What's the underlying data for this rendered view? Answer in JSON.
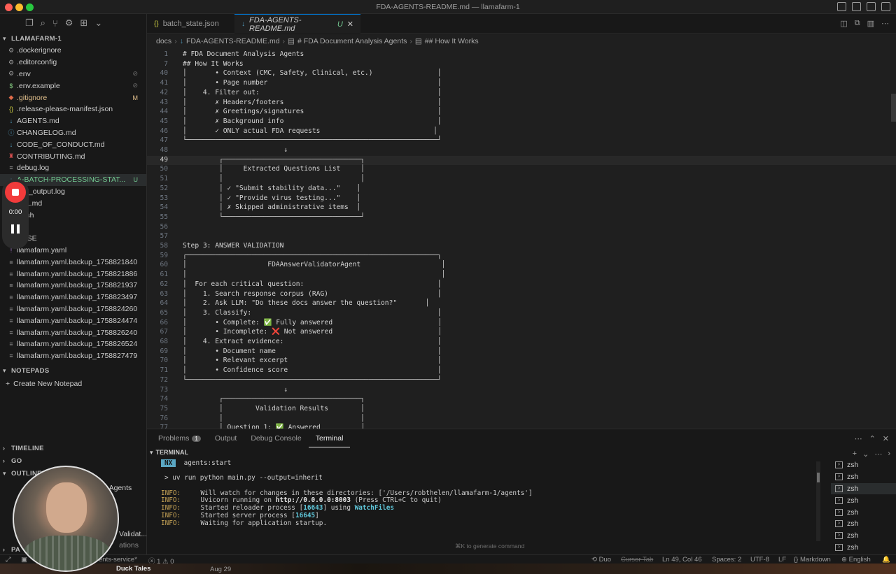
{
  "window": {
    "title": "FDA-AGENTS-README.md — llamafarm-1"
  },
  "sidebar": {
    "project": "LLAMAFARM-1",
    "files": [
      {
        "icon": "gear",
        "name": ".dockerignore",
        "badge": "",
        "color": "#cccccc"
      },
      {
        "icon": "gear",
        "name": ".editorconfig",
        "badge": "",
        "color": "#cccccc"
      },
      {
        "icon": "gear",
        "name": ".env",
        "badge": "⊘",
        "color": "#cccccc"
      },
      {
        "icon": "dollar",
        "name": ".env.example",
        "badge": "⊘",
        "color": "#cccccc"
      },
      {
        "icon": "git",
        "name": ".gitignore",
        "badge": "M",
        "color": "#e2c08d"
      },
      {
        "icon": "braces",
        "name": ".release-please-manifest.json",
        "badge": "",
        "color": "#cccccc"
      },
      {
        "icon": "md",
        "name": "AGENTS.md",
        "badge": "",
        "color": "#cccccc"
      },
      {
        "icon": "info",
        "name": "CHANGELOG.md",
        "badge": "",
        "color": "#cccccc"
      },
      {
        "icon": "md",
        "name": "CODE_OF_CONDUCT.md",
        "badge": "",
        "color": "#cccccc"
      },
      {
        "icon": "contrib",
        "name": "CONTRIBUTING.md",
        "badge": "",
        "color": "#cccccc"
      },
      {
        "icon": "lines",
        "name": "debug.log",
        "badge": "",
        "color": "#cccccc"
      },
      {
        "icon": "md",
        "name": "A-BATCH-PROCESSING-STAT...",
        "badge": "U",
        "color": "#73c991"
      },
      {
        "icon": "lines",
        "name": "test_output.log",
        "badge": "",
        "color": "#cccccc"
      },
      {
        "icon": "md",
        "name": "ALL.md",
        "badge": "",
        "color": "#cccccc"
      },
      {
        "icon": "dollar",
        "name": "all.sh",
        "badge": "",
        "color": "#cccccc"
      },
      {
        "icon": "none",
        "name": "",
        "badge": "",
        "color": "#cccccc"
      },
      {
        "icon": "lines",
        "name": "ENSE",
        "badge": "",
        "color": "#cccccc"
      },
      {
        "icon": "yaml",
        "name": "llamafarm.yaml",
        "badge": "",
        "color": "#cccccc"
      },
      {
        "icon": "lines",
        "name": "llamafarm.yaml.backup_1758821840",
        "badge": "",
        "color": "#cccccc"
      },
      {
        "icon": "lines",
        "name": "llamafarm.yaml.backup_1758821886",
        "badge": "",
        "color": "#cccccc"
      },
      {
        "icon": "lines",
        "name": "llamafarm.yaml.backup_1758821937",
        "badge": "",
        "color": "#cccccc"
      },
      {
        "icon": "lines",
        "name": "llamafarm.yaml.backup_1758823497",
        "badge": "",
        "color": "#cccccc"
      },
      {
        "icon": "lines",
        "name": "llamafarm.yaml.backup_1758824260",
        "badge": "",
        "color": "#cccccc"
      },
      {
        "icon": "lines",
        "name": "llamafarm.yaml.backup_1758824474",
        "badge": "",
        "color": "#cccccc"
      },
      {
        "icon": "lines",
        "name": "llamafarm.yaml.backup_1758826240",
        "badge": "",
        "color": "#cccccc"
      },
      {
        "icon": "lines",
        "name": "llamafarm.yaml.backup_1758826524",
        "badge": "",
        "color": "#cccccc"
      },
      {
        "icon": "lines",
        "name": "llamafarm.yaml.backup_1758827479",
        "badge": "",
        "color": "#cccccc"
      }
    ],
    "notepads_label": "NOTEPADS",
    "create_notepad": "Create New Notepad",
    "timeline_label": "TIMELINE",
    "go_label": "GO",
    "outline_label": "OUTLINE",
    "outline_peek1": "s Agents",
    "outline_peek2": "Validat...",
    "outline_peek3": "ations",
    "pa_label": "PA"
  },
  "recording": {
    "time": "0:00"
  },
  "tabs": [
    {
      "label": "batch_state.json",
      "icon": "{}",
      "active": false,
      "modified": ""
    },
    {
      "label": "FDA-AGENTS-README.md",
      "icon": "↓",
      "active": true,
      "modified": "U"
    }
  ],
  "breadcrumb": [
    "docs",
    "FDA-AGENTS-README.md",
    "# FDA Document Analysis Agents",
    "## How It Works"
  ],
  "editor": {
    "current_line": "49",
    "lines": [
      {
        "n": "1",
        "t": "# FDA Document Analysis Agents"
      },
      {
        "n": "7",
        "t": "## How It Works"
      },
      {
        "n": "40",
        "t": "│       • Context (CMC, Safety, Clinical, etc.)                │"
      },
      {
        "n": "41",
        "t": "│       • Page number                                          │"
      },
      {
        "n": "42",
        "t": "│    4. Filter out:                                            │"
      },
      {
        "n": "43",
        "t": "│       ✗ Headers/footers                                      │"
      },
      {
        "n": "44",
        "t": "│       ✗ Greetings/signatures                                 │"
      },
      {
        "n": "45",
        "t": "│       ✗ Background info                                      │"
      },
      {
        "n": "46",
        "t": "│       ✓ ONLY actual FDA requests                            │"
      },
      {
        "n": "47",
        "t": "└──────────────────────────────────────────────────────────────┘"
      },
      {
        "n": "48",
        "t": "                         ↓"
      },
      {
        "n": "49",
        "t": "         ┌──────────────────────────────────┐"
      },
      {
        "n": "50",
        "t": "         │     Extracted Questions List     │"
      },
      {
        "n": "51",
        "t": "         │                                  │"
      },
      {
        "n": "52",
        "t": "         │ ✓ \"Submit stability data...\"    │"
      },
      {
        "n": "53",
        "t": "         │ ✓ \"Provide virus testing...\"    │"
      },
      {
        "n": "54",
        "t": "         │ ✗ Skipped administrative items  │"
      },
      {
        "n": "55",
        "t": "         └──────────────────────────────────┘"
      },
      {
        "n": "56",
        "t": ""
      },
      {
        "n": "57",
        "t": ""
      },
      {
        "n": "58",
        "t": "Step 3: ANSWER VALIDATION"
      },
      {
        "n": "59",
        "t": "┌──────────────────────────────────────────────────────────────┐"
      },
      {
        "n": "60",
        "t": "│                    FDAAnswerValidatorAgent                    │"
      },
      {
        "n": "61",
        "t": "│                                                               │"
      },
      {
        "n": "62",
        "t": "│  For each critical question:                                 │"
      },
      {
        "n": "63",
        "t": "│    1. Search response corpus (RAG)                           │"
      },
      {
        "n": "64",
        "t": "│    2. Ask LLM: \"Do these docs answer the question?\"       │"
      },
      {
        "n": "65",
        "t": "│    3. Classify:                                              │"
      },
      {
        "n": "66",
        "t": "│       • Complete: ✅ Fully answered                          │"
      },
      {
        "n": "67",
        "t": "│       • Incomplete: ❌ Not answered                          │"
      },
      {
        "n": "68",
        "t": "│    4. Extract evidence:                                      │"
      },
      {
        "n": "69",
        "t": "│       • Document name                                        │"
      },
      {
        "n": "70",
        "t": "│       • Relevant excerpt                                     │"
      },
      {
        "n": "71",
        "t": "│       • Confidence score                                     │"
      },
      {
        "n": "72",
        "t": "└──────────────────────────────────────────────────────────────┘"
      },
      {
        "n": "73",
        "t": "                         ↓"
      },
      {
        "n": "74",
        "t": "         ┌──────────────────────────────────┐"
      },
      {
        "n": "75",
        "t": "         │        Validation Results        │"
      },
      {
        "n": "76",
        "t": "         │                                  │"
      },
      {
        "n": "77",
        "t": "         │ Question 1: ✅ Answered          │"
      }
    ]
  },
  "panel": {
    "tabs": [
      {
        "label": "Problems",
        "badge": "1",
        "active": false
      },
      {
        "label": "Output",
        "badge": "",
        "active": false
      },
      {
        "label": "Debug Console",
        "badge": "",
        "active": false
      },
      {
        "label": "Terminal",
        "badge": "",
        "active": true
      }
    ],
    "terminal_header": "TERMINAL",
    "nx_tag": "NX",
    "nx_text": "agents:start",
    "command": "> uv run python main.py --output=inherit",
    "info_label": "INFO:",
    "info1": "Will watch for changes in these directories: ['/Users/robthelen/llamafarm-1/agents']",
    "info2_pre": "Uvicorn running on ",
    "info2_url": "http://0.0.0.0:8003",
    "info2_post": " (Press CTRL+C to quit)",
    "info3_pre": "Started reloader process [",
    "info3_pid": "16643",
    "info3_mid": "] using ",
    "info3_tool": "WatchFiles",
    "info4_pre": "Started server process [",
    "info4_pid": "16645",
    "info4_post": "]",
    "info5": "Waiting for application startup.",
    "hint": "⌘K to generate command",
    "shells": [
      "zsh",
      "zsh",
      "zsh",
      "zsh",
      "zsh",
      "zsh",
      "zsh",
      "zsh"
    ],
    "active_shell": 2
  },
  "status": {
    "branch_partial": "ents-service*",
    "errors": "ⓧ 1 ⚠ 0",
    "duo": "Duo",
    "cursor_tab": "Cursor Tab",
    "position": "Ln 49, Col 46",
    "spaces": "Spaces: 2",
    "encoding": "UTF-8",
    "eol": "LF",
    "language": "Markdown",
    "locale": "English"
  },
  "desktop": {
    "notification": "Duck Tales",
    "date": "Aug 29"
  }
}
